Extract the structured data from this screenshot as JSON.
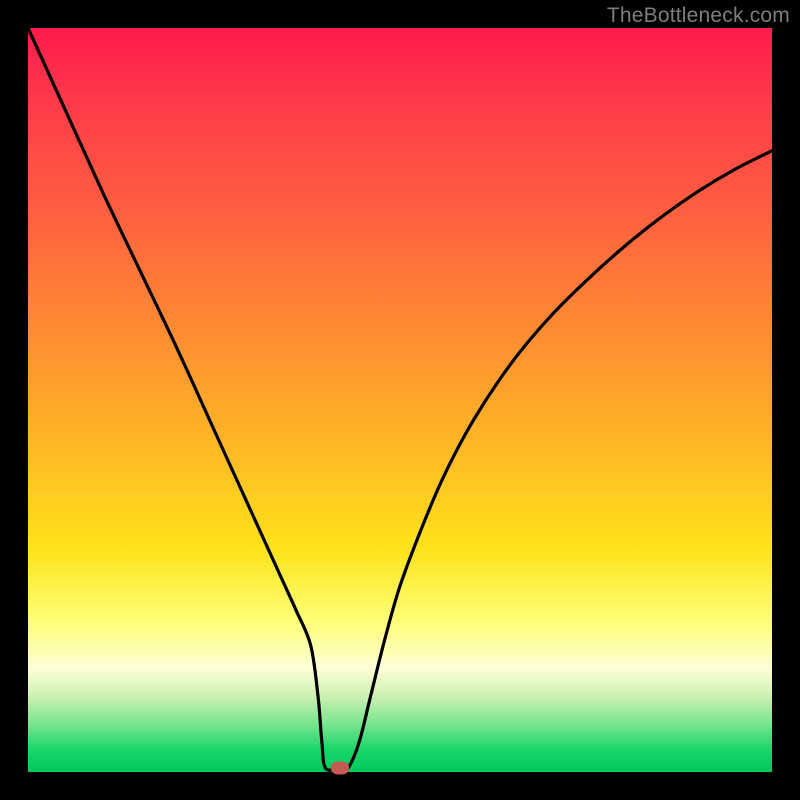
{
  "watermark": "TheBottleneck.com",
  "colors": {
    "frame": "#000000",
    "marker": "#c55a52",
    "curve": "#000000"
  },
  "chart_data": {
    "type": "line",
    "title": "",
    "xlabel": "",
    "ylabel": "",
    "xlim": [
      0,
      100
    ],
    "ylim": [
      0,
      100
    ],
    "grid": false,
    "legend": false,
    "curve": {
      "x": [
        0,
        5,
        10,
        15,
        20,
        25,
        28,
        30,
        32,
        34,
        36,
        38,
        39,
        39.5,
        40,
        42,
        43,
        44.5,
        46,
        48,
        50,
        53,
        56,
        60,
        65,
        70,
        75,
        80,
        85,
        90,
        95,
        100
      ],
      "y": [
        100,
        89,
        78,
        67.5,
        57,
        46,
        39.4,
        35,
        30.6,
        26.2,
        21.8,
        17,
        10,
        4,
        0.5,
        0.5,
        0.5,
        4,
        10,
        18,
        25,
        33,
        40,
        47.5,
        55,
        61,
        66,
        70.5,
        74.5,
        78,
        81,
        83.5
      ]
    },
    "marker": {
      "x": 42,
      "y": 0.5
    },
    "annotations": []
  }
}
